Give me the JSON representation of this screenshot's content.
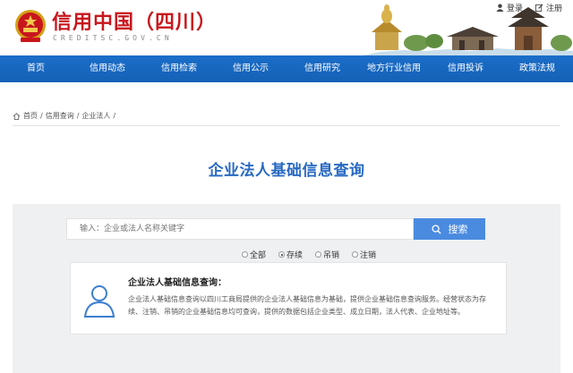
{
  "header": {
    "site_title": "信用中国（四川）",
    "site_subtitle": "CREDITSC.GOV.CN",
    "login": "登录",
    "register": "注册"
  },
  "nav": {
    "items": [
      "首页",
      "信用动态",
      "信用检索",
      "信用公示",
      "信用研究",
      "地方行业信用",
      "信用投诉",
      "政策法规"
    ]
  },
  "breadcrumb": {
    "home": "首页",
    "level1": "信用查询",
    "level2": "企业法人"
  },
  "page_title": "企业法人基础信息查询",
  "search": {
    "placeholder": "输入：企业或法人名称关键字",
    "button_label": "搜索"
  },
  "filters": {
    "options": [
      "全部",
      "存续",
      "吊销",
      "注销"
    ],
    "selected": "存续"
  },
  "info": {
    "title": "企业法人基础信息查询：",
    "text": "企业法人基础信息查询以四川工商局提供的企业法人基础信息为基础，提供企业基础信息查询服务。经营状态为存续、注销、吊销的企业基础信息均可查询，提供的数据包括企业类型、成立日期，法人代表、企业地址等。"
  },
  "colors": {
    "brand_red": "#c8161d",
    "nav_blue": "#1b6ec9",
    "title_blue": "#2869c2",
    "button_blue": "#4a8be0"
  }
}
